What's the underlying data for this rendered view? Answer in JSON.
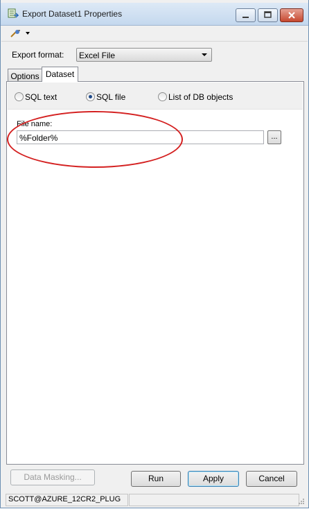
{
  "window": {
    "title": "Export Dataset1 Properties",
    "icon": "dataset-export-icon"
  },
  "toolbar": {
    "tools_icon": "wand-plug-icon",
    "dropdown_icon": "chevron-down-icon"
  },
  "export_format": {
    "label": "Export format:",
    "value": "Excel File"
  },
  "tabs": [
    {
      "label": "Options"
    },
    {
      "label": "Dataset"
    }
  ],
  "source_options": [
    {
      "label": "SQL text",
      "selected": false
    },
    {
      "label": "SQL file",
      "selected": true
    },
    {
      "label": "List of DB objects",
      "selected": false
    }
  ],
  "file_name": {
    "label": "File name:",
    "value": "%Folder%",
    "browse_label": "..."
  },
  "buttons": {
    "data_masking": "Data Masking...",
    "run": "Run",
    "apply": "Apply",
    "cancel": "Cancel"
  },
  "status": {
    "connection": "SCOTT@AZURE_12CR2_PLUG"
  },
  "colors": {
    "highlight_ellipse": "#d42020",
    "title_bar": "#c4d8ee"
  }
}
